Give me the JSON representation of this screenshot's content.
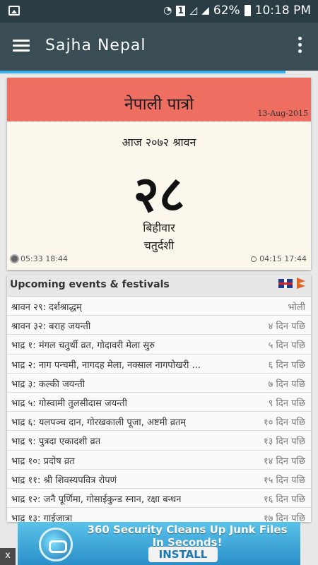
{
  "status_bar": {
    "battery": "62%",
    "time": "10:18 PM",
    "sim": "1"
  },
  "app_bar": {
    "title": "Sajha Nepal"
  },
  "calendar": {
    "title": "नेपाली पात्रो",
    "english_date": "13-Aug-2015",
    "today_label": "आज २०७२ श्रावन",
    "day": "२८",
    "weekday": "बिहीवार",
    "tithi": "चतुर्दशी",
    "sun_times": "05:33 18:44",
    "moon_times": "04:15 17:44"
  },
  "events": {
    "title": "Upcoming events & festivals",
    "items": [
      {
        "name": "श्रावन २९: दर्शश्राद्धम्",
        "when": "भोली"
      },
      {
        "name": "श्रावन ३२: बराह जयन्ती",
        "when": "४ दिन पछि"
      },
      {
        "name": "भाद्र १: मंगल चतुर्थी व्रत, गोदावरी मेला सुरु",
        "when": "५ दिन पछि"
      },
      {
        "name": "भाद्र २: नाग पन्चमी, नागदह मेला, नक्साल नागपोखरी ...",
        "when": "६ दिन पछि"
      },
      {
        "name": "भाद्र ३: कल्की जयन्ती",
        "when": "७ दिन पछि"
      },
      {
        "name": "भाद्र ५: गोस्वामी तुलसीदास जयन्ती",
        "when": "९ दिन पछि"
      },
      {
        "name": "भाद्र ६: यलपञ्च दान, गोरखकाली पूजा, अष्टमी व्रतम्",
        "when": "१० दिन पछि"
      },
      {
        "name": "भाद्र ९: पुत्रदा एकादशी व्रत",
        "when": "१३ दिन पछि"
      },
      {
        "name": "भाद्र १०: प्रदोष व्रत",
        "when": "१४ दिन पछि"
      },
      {
        "name": "भाद्र ११: श्री शिवस्यपवित्र रोपणं",
        "when": "१५ दिन पछि"
      },
      {
        "name": "भाद्र १२: जनै पूर्णिमा, गोसाईकुन्ड स्नान, रक्षा बन्धन",
        "when": "१६ दिन पछि"
      },
      {
        "name": "भाद्र १३: गाईजात्रा",
        "when": "१७ दिन पछि"
      }
    ]
  },
  "ad": {
    "headline_1": "360 Security Cleans Up Junk Files",
    "headline_2": "In Seconds!",
    "cta": "INSTALL",
    "close": "x"
  }
}
